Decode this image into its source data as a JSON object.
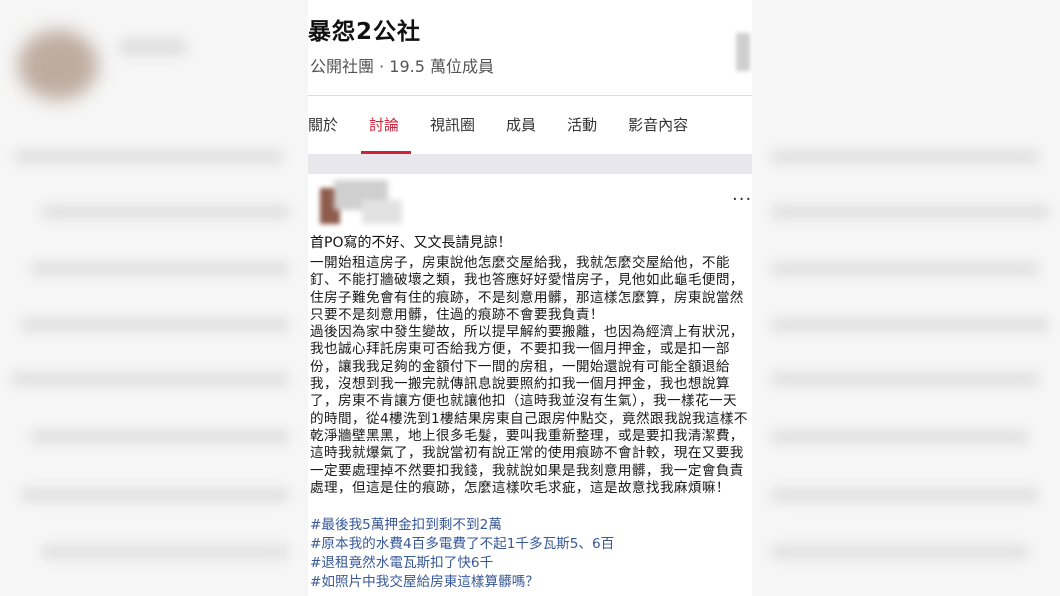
{
  "group": {
    "title": "暴怨2公社",
    "meta": "公開社團 · 19.5 萬位成員"
  },
  "tabs": [
    {
      "label": "關於",
      "active": false
    },
    {
      "label": "討論",
      "active": true
    },
    {
      "label": "視訊圈",
      "active": false
    },
    {
      "label": "成員",
      "active": false
    },
    {
      "label": "活動",
      "active": false
    },
    {
      "label": "影音內容",
      "active": false
    }
  ],
  "post": {
    "more_label": "···",
    "intro": "首PO寫的不好、又文長請見諒！",
    "lines": [
      "一開始租這房子，房東說他怎麼交屋給我，我就怎麼交屋給他，不能",
      "釘、不能打牆破壞之類，我也答應好好愛惜房子，見他如此龜毛便問，",
      "住房子難免會有住的痕跡，不是刻意用髒，那這樣怎麼算，房東說當然",
      "只要不是刻意用髒，住過的痕跡不會要我負責！",
      "過後因為家中發生變故，所以提早解約要搬離，也因為經濟上有狀況，",
      "我也誠心拜託房東可否給我方便，不要扣我一個月押金，或是扣一部",
      "份，讓我我足夠的金額付下一間的房租，一開始還說有可能全額退給",
      "我，沒想到我一搬完就傳訊息說要照約扣我一個月押金，我也想說算",
      "了，房東不肯讓方便也就讓他扣（這時我並沒有生氣），我一樣花一天",
      "的時間，從4樓洗到1樓結果房東自己跟房仲點交，竟然跟我說我這樣不",
      "乾淨牆壁黑黑，地上很多毛髮，要叫我重新整理，或是要扣我清潔費，",
      "這時我就爆氣了，我說當初有說正常的使用痕跡不會計較，現在又要我",
      "一定要處理掉不然要扣我錢，我就說如果是我刻意用髒，我一定會負責",
      "處理，但這是住的痕跡，怎麼這樣吹毛求疵，這是故意找我麻煩嘛！"
    ],
    "hashtags": [
      "#最後我5萬押金扣到剩不到2萬",
      "#原本我的水費4百多電費了不起1千多瓦斯5、6百",
      "#退租竟然水電瓦斯扣了快6千",
      "#如照片中我交屋給房東這樣算髒嗎？"
    ]
  },
  "colors": {
    "accent": "#d0213a",
    "hashtag": "#385898"
  }
}
